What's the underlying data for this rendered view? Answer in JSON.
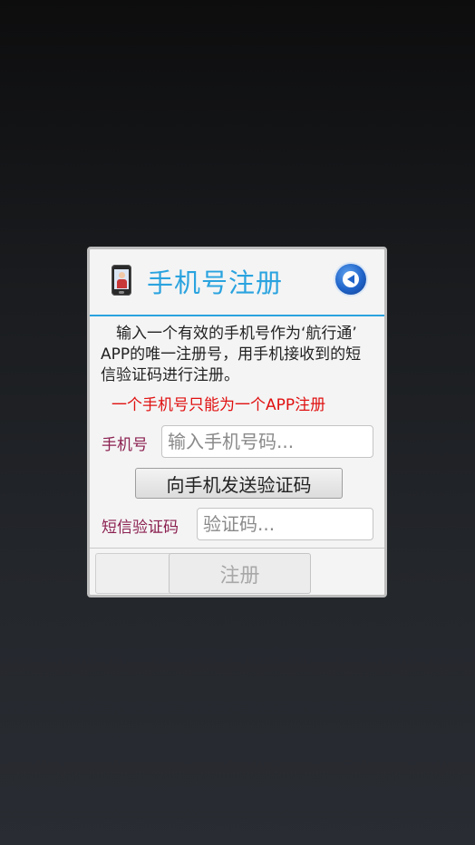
{
  "dialog": {
    "title": "手机号注册",
    "description": "　输入一个有效的手机号作为‘航行通’ APP的唯一注册号，用手机接收到的短信验证码进行注册。",
    "warning": "一个手机号只能为一个APP注册",
    "phone_label": "手机号",
    "phone_placeholder": "输入手机号码...",
    "phone_value": "",
    "send_code_label": "向手机发送验证码",
    "sms_label": "短信验证码",
    "sms_placeholder": "验证码...",
    "sms_value": "",
    "register_label": "注册",
    "icons": [
      "phone-app-icon",
      "back-arrow-icon"
    ],
    "colors": {
      "title": "#2aa3df",
      "warning": "#e01010",
      "label": "#8b2050",
      "divider": "#2aa3df"
    }
  }
}
